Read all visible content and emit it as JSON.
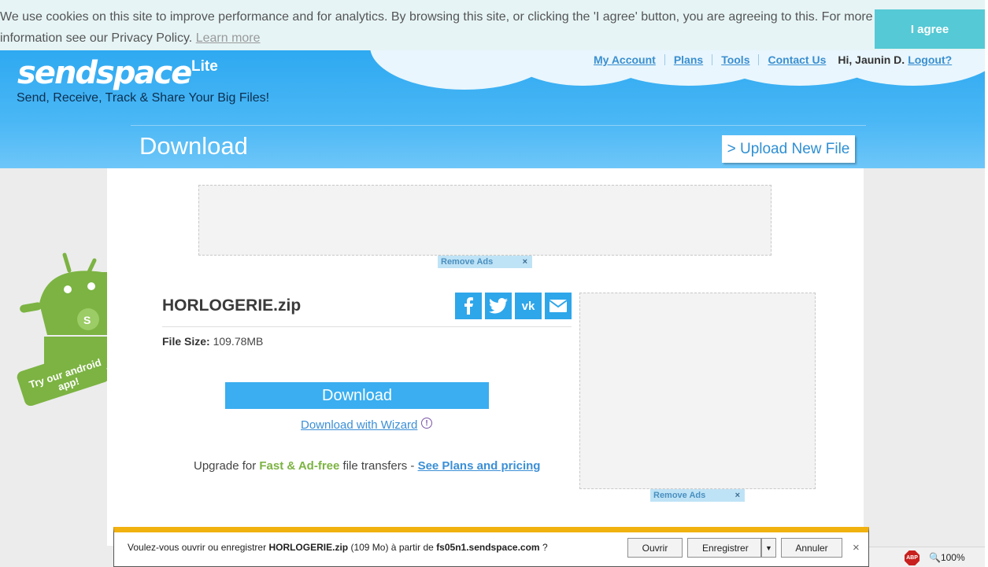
{
  "cookie": {
    "text": "We use cookies on this site to improve performance and for analytics. By browsing this site, or clicking the 'I agree' button, you are agreeing to this. For more information see our Privacy Policy.",
    "learn_more": "Learn more",
    "agree": "I agree"
  },
  "header": {
    "logo": "sendspace",
    "logo_badge": "Lite",
    "tagline": "Send, Receive, Track & Share Your Big Files!",
    "nav": [
      "My Account",
      "Plans",
      "Tools",
      "Contact Us"
    ],
    "greeting": "Hi, Jaunin D.",
    "logout": "Logout?",
    "page_title": "Download",
    "upload_button": "> Upload New File"
  },
  "ads": {
    "remove_label": "Remove Ads",
    "close": "×"
  },
  "android_promo": "Try our android app!",
  "file": {
    "name": "HORLOGERIE.zip",
    "size_label": "File Size:",
    "size_value": "109.78MB"
  },
  "social_icons": [
    "facebook-icon",
    "twitter-icon",
    "vk-icon",
    "email-icon"
  ],
  "download": {
    "button": "Download",
    "wizard_link": "Download with Wizard"
  },
  "upgrade": {
    "prefix": "Upgrade for",
    "highlight": "Fast & Ad-free",
    "middle": "file transfers -",
    "link": "See Plans and pricing"
  },
  "notification": {
    "prefix": "Voulez-vous ouvrir ou enregistrer",
    "filename": "HORLOGERIE.zip",
    "size": "(109 Mo) à partir de",
    "host": "fs05n1.sendspace.com",
    "suffix": "?",
    "open": "Ouvrir",
    "save": "Enregistrer",
    "cancel": "Annuler",
    "close": "×"
  },
  "status": {
    "abp": "ABP",
    "zoom": "100%"
  },
  "colors": {
    "accent": "#3aaef0",
    "cookie_button": "#55c9d5",
    "notif_bar": "#f1b10f"
  }
}
